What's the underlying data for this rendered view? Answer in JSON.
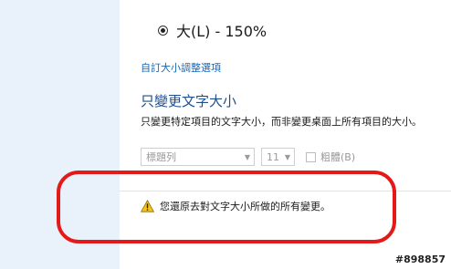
{
  "scaling": {
    "selected_option_label": "大(L) - 150%",
    "custom_link": "自訂大小調整選項"
  },
  "text_only": {
    "title": "只變更文字大小",
    "description": "只變更特定項目的文字大小，而非變更桌面上所有項目的大小。",
    "item_select_value": "標題列",
    "size_select_value": "11",
    "bold_label": "粗體(B)",
    "bold_checked": false
  },
  "warning": {
    "icon": "warning-icon",
    "text": "您還原去對文字大小所做的所有變更。"
  },
  "annotation": {
    "color": "#e21a1a"
  },
  "watermark": "#898857"
}
